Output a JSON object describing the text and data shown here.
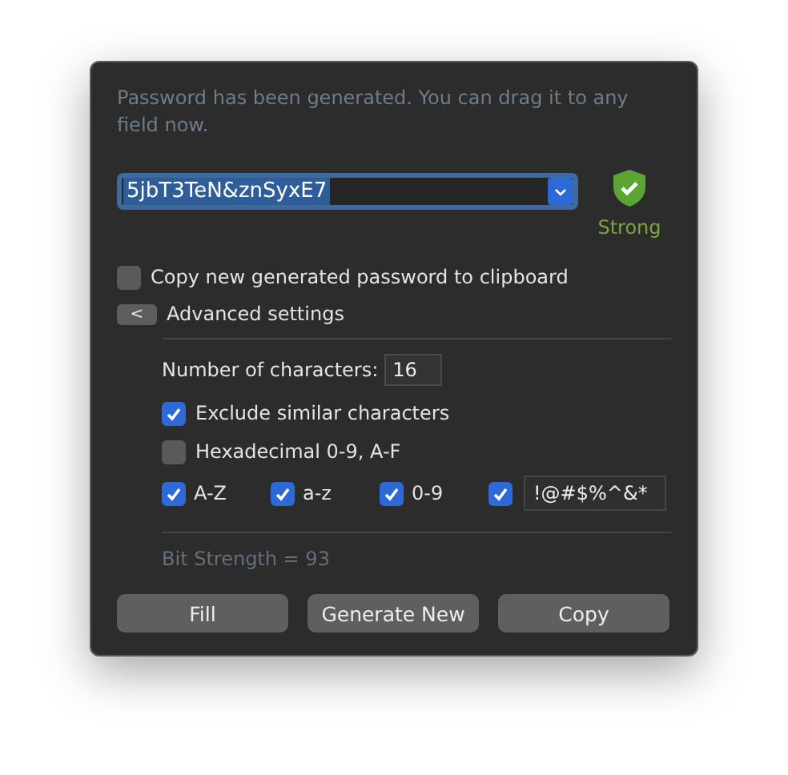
{
  "message": "Password has been generated. You can drag it to any field now.",
  "password": {
    "value": "5jbT3TeN&znSyxE7",
    "text_selected": true
  },
  "strength": {
    "label": "Strong"
  },
  "copy_to_clipboard": {
    "label": "Copy new generated password to clipboard",
    "checked": false
  },
  "advanced": {
    "toggle": "<",
    "label": "Advanced settings",
    "expanded": true
  },
  "length": {
    "label": "Number of characters:",
    "value": "16"
  },
  "options": [
    {
      "label": "Exclude similar characters",
      "checked": true
    },
    {
      "label": "Hexadecimal 0-9, A-F",
      "checked": false
    }
  ],
  "charsets": [
    {
      "kind": "label",
      "label": "A-Z",
      "checked": true
    },
    {
      "kind": "label",
      "label": "a-z",
      "checked": true
    },
    {
      "kind": "label",
      "label": "0-9",
      "checked": true
    },
    {
      "kind": "field",
      "value": "!@#$%^&*",
      "checked": true
    }
  ],
  "bit_strength": "Bit Strength = 93",
  "buttons": [
    "Fill",
    "Generate New",
    "Copy"
  ]
}
